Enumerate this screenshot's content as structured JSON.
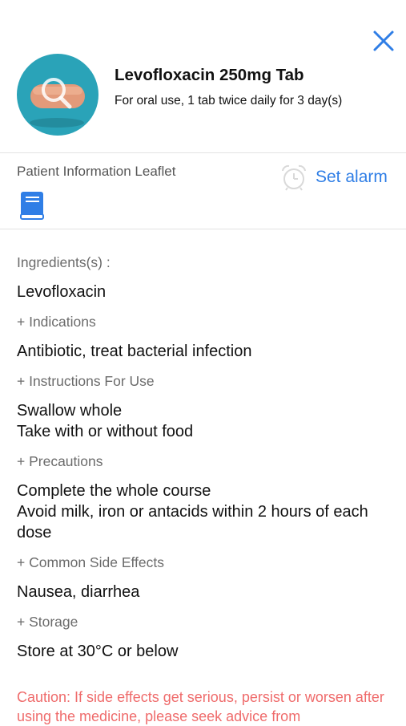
{
  "header": {
    "medicine_name": "Levofloxacin 250mg Tab",
    "dosage_instructions": "For oral use,  1 tab  twice daily for 3 day(s)",
    "close_icon": "close-icon",
    "image_icon": "magnifier-icon"
  },
  "leaflet": {
    "label": "Patient Information Leaflet",
    "icon": "book-icon"
  },
  "alarm": {
    "label": "Set alarm",
    "icon": "alarm-clock-icon"
  },
  "sections": {
    "ingredients": {
      "label": "Ingredients(s) :",
      "value": "Levofloxacin"
    },
    "indications": {
      "label": "+ Indications",
      "value": "Antibiotic, treat bacterial infection"
    },
    "instructions": {
      "label": "+ Instructions For Use",
      "value": "Swallow whole\nTake with or without food"
    },
    "precautions": {
      "label": "+ Precautions",
      "value": "Complete the whole course\nAvoid milk, iron or antacids within 2 hours of each dose"
    },
    "side_effects": {
      "label": "+ Common Side Effects",
      "value": "Nausea, diarrhea"
    },
    "storage": {
      "label": "+ Storage",
      "value": "Store at 30°C or below"
    }
  },
  "caution": "Caution: If side effects get serious, persist or worsen after using the medicine, please seek advice from",
  "colors": {
    "accent": "#2f7ee6",
    "image_bg": "#2aa3b8",
    "caution": "#ef6b6b",
    "divider": "#e2e2e2"
  }
}
